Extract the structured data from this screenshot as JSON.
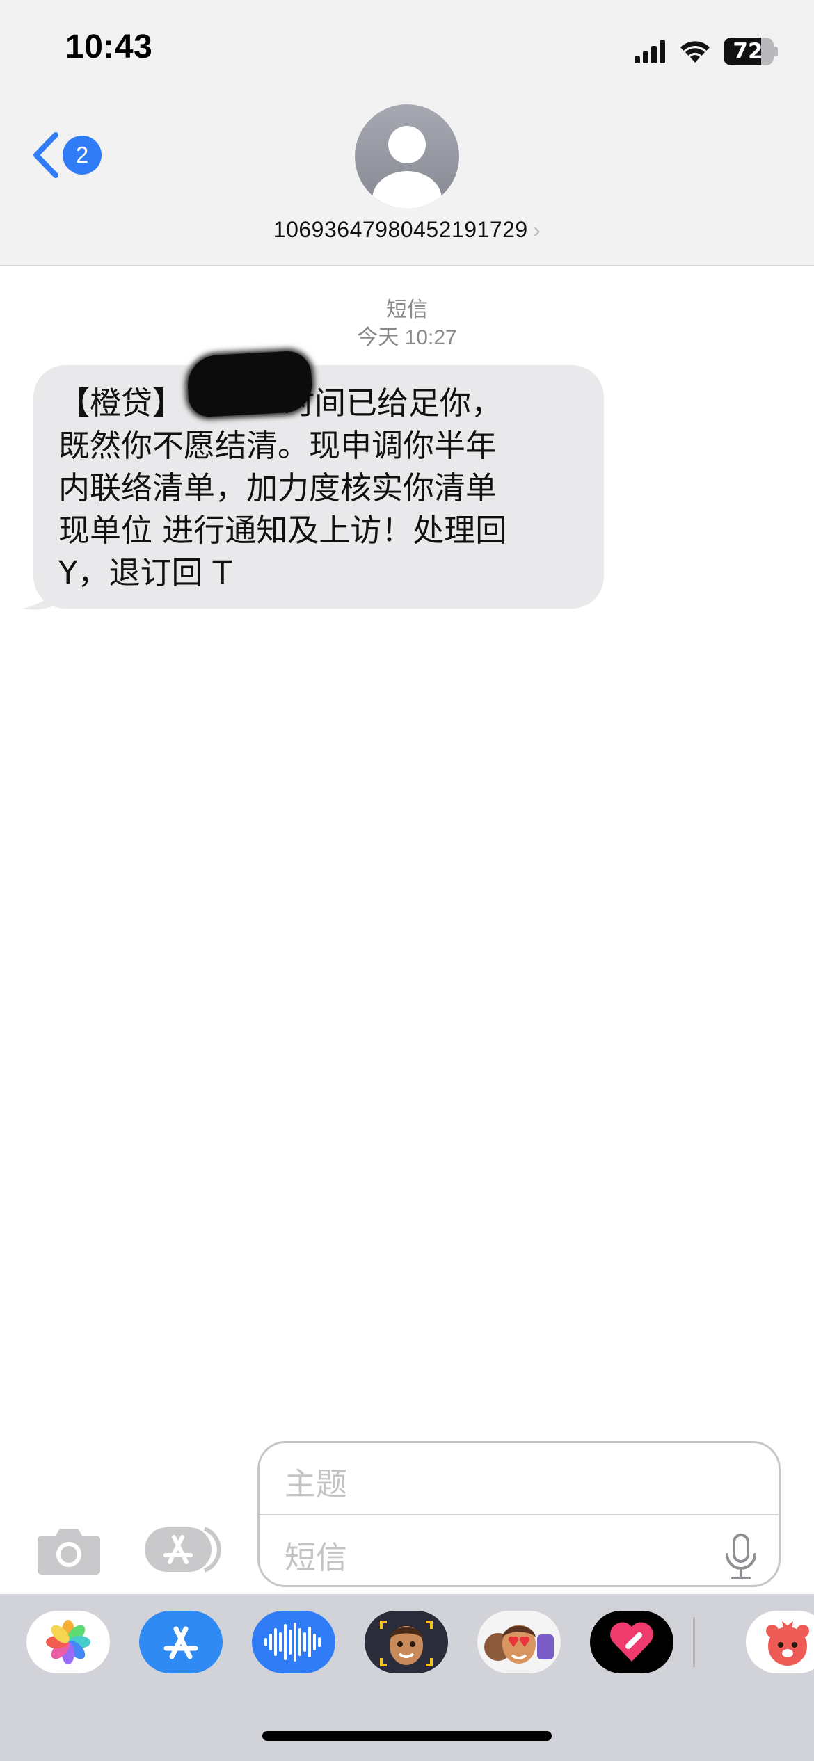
{
  "status_bar": {
    "time": "10:43",
    "battery": "72"
  },
  "nav": {
    "back_badge": "2",
    "contact": "1069364798045219172​9",
    "chevron": "›"
  },
  "conversation": {
    "service": "短信",
    "timestamp": "今天 10:27",
    "messages": [
      {
        "direction": "incoming",
        "text": "【橙贷】          时间已给足你，\n既然你不愿结清。现申调你半年\n内联络清单，加力度核实你清单\n现单位 进行通知及上访！处理回\nY，退订回 T"
      }
    ]
  },
  "composer": {
    "subject_placeholder": "主题",
    "message_placeholder": "短信"
  },
  "app_drawer": {
    "apps": [
      "photos-app",
      "app-store-app",
      "audio-message-app",
      "memoji-app",
      "memoji-stickers-app",
      "digital-touch-app",
      "sticker-app"
    ]
  },
  "colors": {
    "accent": "#2f7cf6",
    "bubble": "#e9e9eb",
    "drawer": "#d2d3d8"
  }
}
